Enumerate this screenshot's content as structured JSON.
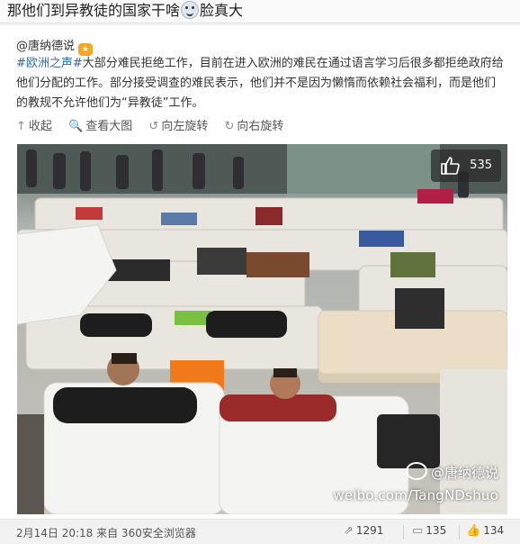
{
  "header": {
    "title_before": "那他们到异教徒的国家干啥",
    "title_after": "脸真大",
    "emoji_icon": "face-emoji"
  },
  "post": {
    "author": "@唐纳德说",
    "author_badge_icon": "vip-badge-icon",
    "hashtag": "#欧洲之声#",
    "text": "大部分难民拒绝工作，目前在进入欧洲的难民在通过语言学习后很多都拒绝政府给他们分配的工作。部分接受调查的难民表示，他们并不是因为懒惰而依赖社会福利，而是他们的教规不允许他们为“异教徒”工作。"
  },
  "media_actions": {
    "collapse": "收起",
    "view_large": "查看大图",
    "rotate_left": "向左旋转",
    "rotate_right": "向右旋转"
  },
  "photo": {
    "like_count": "535",
    "watermark_name": "@唐纳德说",
    "watermark_url": "weibo.com/TangNDshuo"
  },
  "footer": {
    "timestamp": "2月14日 20:18 来自 360安全浏览器",
    "reposts": "1291",
    "comments": "135",
    "likes": "134"
  },
  "colors": {
    "link": "#2c6bb0",
    "text": "#333333",
    "background": "#f2f2f2"
  }
}
